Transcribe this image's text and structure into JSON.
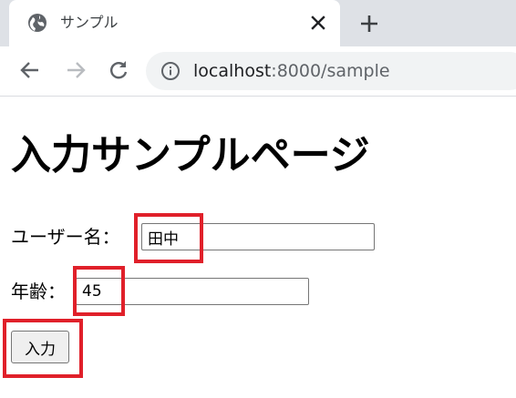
{
  "browser": {
    "tab_title": "サンプル",
    "url_host": "localhost",
    "url_rest": ":8000/sample"
  },
  "page": {
    "title": "入力サンプルページ",
    "username_label": "ユーザー名：",
    "username_value": "田中",
    "age_label": "年齢：",
    "age_value": "45",
    "submit_label": "入力"
  },
  "colors": {
    "highlight": "#e0202a",
    "tabstrip": "#dee1e6",
    "omnibox": "#f1f3f4"
  },
  "icons": {
    "favicon": "globe-icon",
    "tab_close": "close-icon",
    "new_tab": "plus-icon",
    "back": "back-arrow-icon",
    "forward": "forward-arrow-icon",
    "reload": "reload-icon",
    "site_info": "info-icon"
  }
}
